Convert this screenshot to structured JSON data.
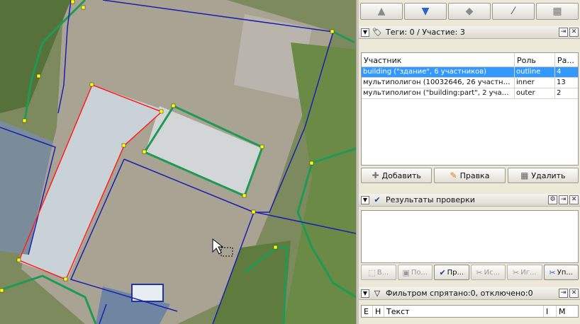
{
  "toolbar": {
    "buttons": [
      {
        "icon": "arrow-up-icon",
        "glyph": "▲"
      },
      {
        "icon": "arrow-down-icon",
        "glyph": "▼"
      },
      {
        "icon": "zoom-to-icon",
        "glyph": "◆"
      },
      {
        "icon": "wand-icon",
        "glyph": "⁄"
      },
      {
        "icon": "trash-icon",
        "glyph": "🗑"
      }
    ]
  },
  "relation_dialog": {
    "title": "Теги: 0 / Участие: 3",
    "columns": [
      "Участник",
      "Роль",
      "Ра..."
    ],
    "rows": [
      {
        "member": "building (\"здание\", 6 участников)",
        "role": "outline",
        "pos": "4",
        "selected": true
      },
      {
        "member": "мультиполигон (10032646, 26 участников)",
        "role": "inner",
        "pos": "13",
        "selected": false
      },
      {
        "member": "мультиполигон (\"building:part\", 2 участника)",
        "role": "outer",
        "pos": "2",
        "selected": false
      }
    ],
    "add_label": "Добавить",
    "edit_label": "Правка",
    "delete_label": "Удалить"
  },
  "validation_dialog": {
    "title": "Результаты проверки",
    "buttons": [
      {
        "label": "В...",
        "active": false
      },
      {
        "label": "По...",
        "active": false
      },
      {
        "label": "Пр...",
        "active": true
      },
      {
        "label": "Ис...",
        "active": false
      },
      {
        "label": "Иг...",
        "active": false
      },
      {
        "label": "Уп...",
        "active": true
      }
    ]
  },
  "filter_dialog": {
    "title": "Фильтром спрятано:0, отключено:0",
    "columns": [
      "E",
      "H",
      "Текст",
      "I",
      "M"
    ]
  },
  "colors": {
    "selection": "#3399ff",
    "way_blue": "#1b1fb0",
    "way_green": "#1f9a55",
    "selected_way": "#ff2020",
    "node_yellow": "#ffff00"
  }
}
